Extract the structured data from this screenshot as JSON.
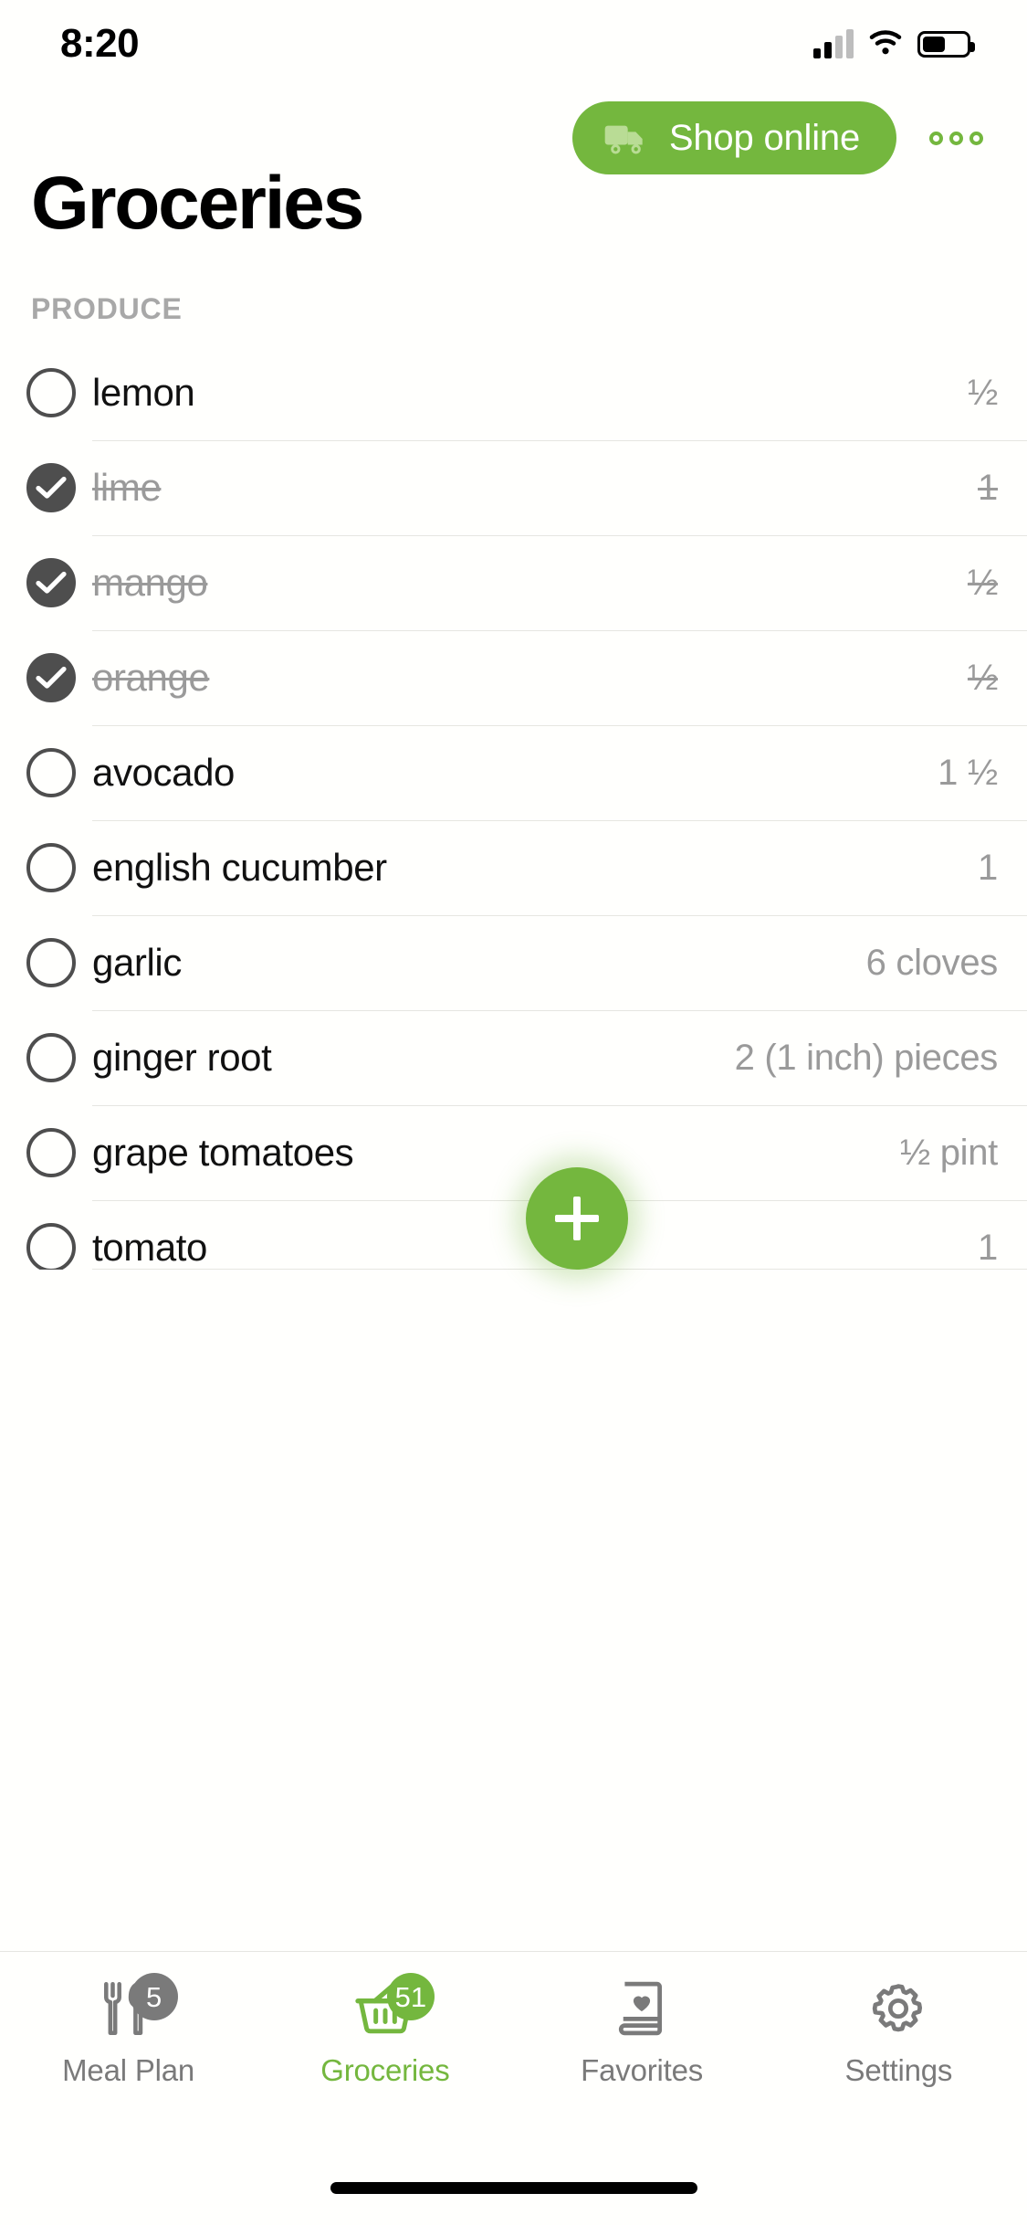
{
  "status_bar": {
    "time": "8:20",
    "signal_icon": "cellular-signal-icon",
    "wifi_icon": "wifi-icon",
    "battery_icon": "battery-icon"
  },
  "header": {
    "shop_online_label": "Shop online",
    "shop_online_icon": "delivery-truck-icon",
    "overflow_icon": "more-options-icon",
    "title": "Groceries",
    "accent_color": "#74B73E"
  },
  "sections": [
    {
      "label": "PRODUCE",
      "items": [
        {
          "name": "lemon",
          "qty": "½",
          "checked": false
        },
        {
          "name": "lime",
          "qty": "1",
          "checked": true
        },
        {
          "name": "mango",
          "qty": "½",
          "checked": true
        },
        {
          "name": "orange",
          "qty": "½",
          "checked": true
        },
        {
          "name": "avocado",
          "qty": "1 ½",
          "checked": false
        },
        {
          "name": "english cucumber",
          "qty": "1",
          "checked": false
        },
        {
          "name": "garlic",
          "qty": "6 cloves",
          "checked": false
        },
        {
          "name": "ginger root",
          "qty": "2 (1 inch) pieces",
          "checked": false
        },
        {
          "name": "grape tomatoes",
          "qty": "½ pint",
          "checked": false
        },
        {
          "name": "tomato",
          "qty": "1",
          "checked": false
        }
      ]
    }
  ],
  "fab": {
    "icon": "plus-icon",
    "label": "+",
    "color": "#74B73E"
  },
  "tab_bar": {
    "tabs": [
      {
        "label": "Meal Plan",
        "icon": "fork-knife-icon",
        "badge": "5",
        "active": false
      },
      {
        "label": "Groceries",
        "icon": "shopping-basket-icon",
        "badge": "51",
        "active": true
      },
      {
        "label": "Favorites",
        "icon": "recipe-book-heart-icon",
        "badge": null,
        "active": false
      },
      {
        "label": "Settings",
        "icon": "gear-icon",
        "badge": null,
        "active": false
      }
    ]
  }
}
